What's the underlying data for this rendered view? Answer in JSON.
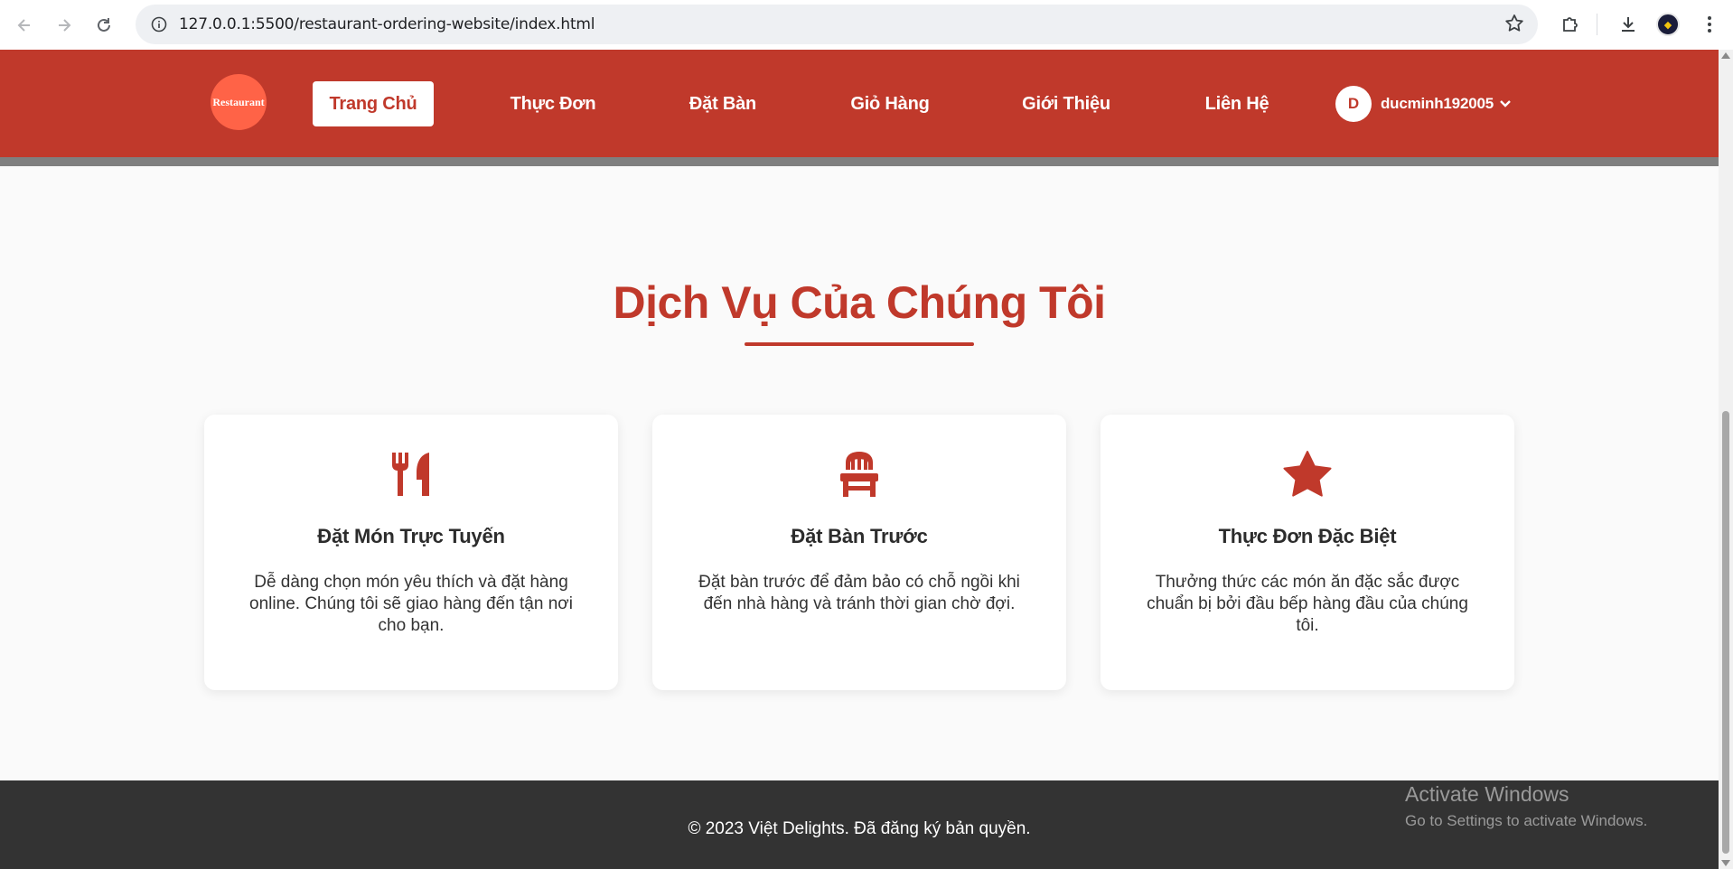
{
  "browser": {
    "url": "127.0.0.1:5500/restaurant-ordering-website/index.html",
    "back_icon": "arrow-left-icon",
    "forward_icon": "arrow-right-icon",
    "reload_icon": "reload-icon",
    "site_info_icon": "info-icon",
    "bookmark_icon": "star-outline-icon",
    "extensions_icon": "puzzle-icon",
    "download_icon": "download-icon",
    "menu_icon": "kebab-icon"
  },
  "header": {
    "logo_text": "Restaurant",
    "nav": [
      {
        "label": "Trang Chủ",
        "active": true
      },
      {
        "label": "Thực Đơn",
        "active": false
      },
      {
        "label": "Đặt Bàn",
        "active": false
      },
      {
        "label": "Giỏ Hàng",
        "active": false
      },
      {
        "label": "Giới Thiệu",
        "active": false
      },
      {
        "label": "Liên Hệ",
        "active": false
      }
    ],
    "user": {
      "initial": "D",
      "name": "ducminh192005",
      "chevron_icon": "chevron-down-icon"
    }
  },
  "services": {
    "title": "Dịch Vụ Của Chúng Tôi",
    "cards": [
      {
        "icon": "utensils-icon",
        "title": "Đặt Món Trực Tuyến",
        "text": "Dễ dàng chọn món yêu thích và đặt hàng online. Chúng tôi sẽ giao hàng đến tận nơi cho bạn."
      },
      {
        "icon": "chair-icon",
        "title": "Đặt Bàn Trước",
        "text": "Đặt bàn trước để đảm bảo có chỗ ngồi khi đến nhà hàng và tránh thời gian chờ đợi."
      },
      {
        "icon": "star-icon",
        "title": "Thực Đơn Đặc Biệt",
        "text": "Thưởng thức các món ăn đặc sắc được chuẩn bị bởi đầu bếp hàng đầu của chúng tôi."
      }
    ]
  },
  "footer": {
    "copyright": "© 2023 Việt Delights. Đã đăng ký bản quyền."
  },
  "watermark": {
    "title": "Activate Windows",
    "subtitle": "Go to Settings to activate Windows."
  },
  "colors": {
    "primary": "#c0392b",
    "logo": "#ff6347",
    "footer": "#333333",
    "page_bg": "#fafafa"
  }
}
